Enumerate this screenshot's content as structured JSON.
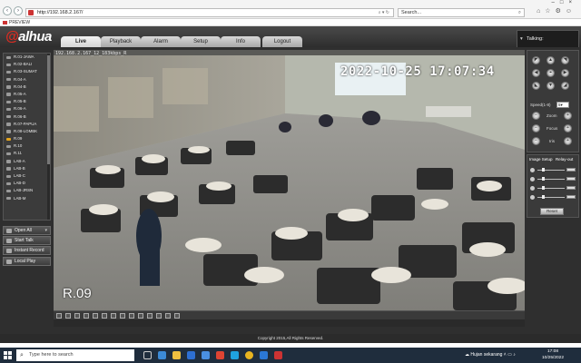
{
  "browser": {
    "address": "http://192.168.2.167/",
    "search_placeholder": "Search...",
    "tab_title": "PREVIEW"
  },
  "app": {
    "logo": "alhua",
    "tabs": [
      "Live",
      "Playback",
      "Alarm",
      "Setup",
      "Info",
      "Logout"
    ],
    "active_tab": "Live",
    "talking_label": "Talking:"
  },
  "channels": [
    "R.01-JAWA",
    "R.02-BALI",
    "R.03-SUMAT",
    "R.04-A",
    "R.04-B",
    "R.05-A",
    "R.05-B",
    "R.06-A",
    "R.06-B",
    "R.07-PAPUA",
    "R.08-LOMBK",
    "R.09",
    "R.10",
    "R.11",
    "LAB-A",
    "LAB-B",
    "LAB-C",
    "LAB-D",
    "LAB-JRSN",
    "LAB-M"
  ],
  "active_channel": "R.09",
  "side_buttons": {
    "open_all": "Open All",
    "start_talk": "Start Talk",
    "instant_record": "Instant Record",
    "local_play": "Local Play"
  },
  "video": {
    "info": "192.168.2.167_12_183kbps_R",
    "timestamp": "2022-10-25 17:07:34",
    "room_label": "R.09"
  },
  "ptz": {
    "speed_label": "Speed(1-8)",
    "speed_value": "5",
    "zoom_label": "Zoom",
    "focus_label": "Focus",
    "iris_label": "Iris"
  },
  "image_setup": {
    "tab_image": "Image Setup",
    "tab_relay": "Relay-out",
    "reset": "Reset",
    "levels": [
      0.2,
      0.2,
      0.2,
      0.2
    ]
  },
  "footer": "Copyright 2015,All Rights Reserved.",
  "taskbar": {
    "search_placeholder": "Type here to search",
    "weather": "Hujan sekarang",
    "time": "17:08",
    "date": "10/25/2022"
  }
}
